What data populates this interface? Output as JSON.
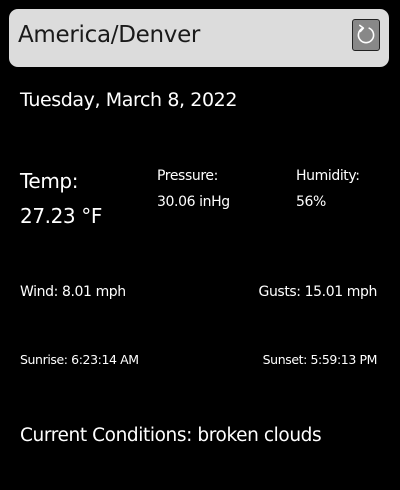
{
  "location": {
    "name": "America/Denver",
    "refresh_icon": "refresh-icon"
  },
  "date": "Tuesday, March 8, 2022",
  "temperature": {
    "label": "Temp:",
    "value": "27.23 °F"
  },
  "pressure": {
    "label": "Pressure:",
    "value": "30.06 inHg"
  },
  "humidity": {
    "label": "Humidity:",
    "value": "56%"
  },
  "wind": "Wind: 8.01 mph",
  "gusts": "Gusts: 15.01 mph",
  "sunrise": "Sunrise: 6:23:14 AM",
  "sunset": "Sunset: 5:59:13 PM",
  "conditions": "Current Conditions: broken clouds",
  "colors": {
    "background": "#000000",
    "text": "#ffffff",
    "location_bar": "#dcdcdc",
    "refresh_button": "#888888"
  }
}
